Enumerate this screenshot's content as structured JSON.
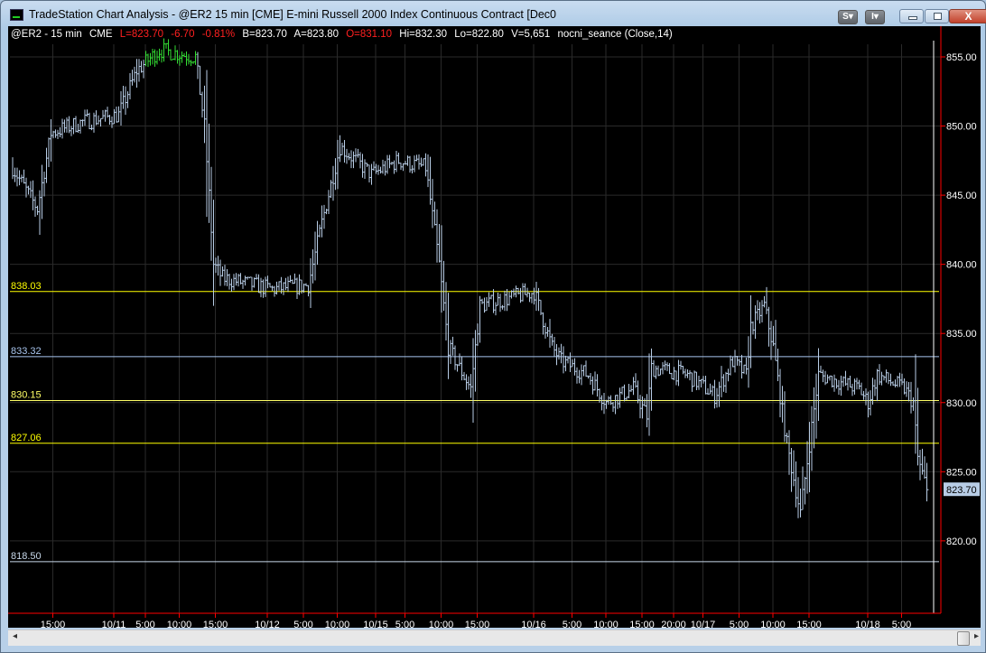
{
  "window": {
    "title": "TradeStation Chart Analysis - @ER2  15 min  [CME] E-mini Russell 2000 Index Continuous Contract [Dec0",
    "buttons": {
      "s": "S",
      "i": "I",
      "minimize": "minimize",
      "maximize": "maximize",
      "close": "X"
    }
  },
  "info": {
    "symbol": "@ER2 - 15 min",
    "exchange": "CME",
    "last": "L=823.70",
    "change": "-6.70",
    "change_pct": "-0.81%",
    "bid": "B=823.70",
    "ask": "A=823.80",
    "open": "O=831.10",
    "high": "Hi=832.30",
    "low": "Lo=822.80",
    "volume": "V=5,651",
    "indicator": "nocni_seance (Close,14)"
  },
  "colors": {
    "bars": "#b8cde6",
    "bars_alt": "#33dd33",
    "yellow": "#ffff00",
    "blue_level": "#a9c6ef",
    "axis": "#ff0000",
    "grid": "#2a2a2a"
  },
  "chart_data": {
    "type": "ohlc",
    "symbol": "@ER2",
    "interval": "15 min",
    "ylim": [
      817,
      857
    ],
    "yticks": [
      "855.00",
      "850.00",
      "845.00",
      "840.00",
      "835.00",
      "830.00",
      "825.00",
      "820.00"
    ],
    "ytick_values": [
      855,
      850,
      845,
      840,
      835,
      830,
      825,
      820
    ],
    "last_price_label": "823.70",
    "last_price": 823.7,
    "bar_count": 412,
    "close_keypoints": [
      [
        1,
        847
      ],
      [
        12,
        844
      ],
      [
        18,
        849.5
      ],
      [
        32,
        850.3
      ],
      [
        48,
        850.8
      ],
      [
        56,
        854
      ],
      [
        66,
        855.5
      ],
      [
        82,
        855
      ],
      [
        86,
        850
      ],
      [
        90,
        840
      ],
      [
        94,
        839
      ],
      [
        116,
        838.2
      ],
      [
        132,
        838.5
      ],
      [
        138,
        843
      ],
      [
        146,
        848.5
      ],
      [
        160,
        846.5
      ],
      [
        172,
        847.5
      ],
      [
        184,
        847
      ],
      [
        190,
        840
      ],
      [
        194,
        834
      ],
      [
        204,
        831
      ],
      [
        208,
        837
      ],
      [
        220,
        837.5
      ],
      [
        232,
        838
      ],
      [
        240,
        834
      ],
      [
        244,
        833
      ],
      [
        256,
        832
      ],
      [
        264,
        830
      ],
      [
        276,
        831
      ],
      [
        282,
        829
      ],
      [
        284,
        832.5
      ],
      [
        300,
        832
      ],
      [
        312,
        830.5
      ],
      [
        320,
        833
      ],
      [
        326,
        832
      ],
      [
        328,
        835.5
      ],
      [
        334,
        837
      ],
      [
        338,
        834
      ],
      [
        344,
        827
      ],
      [
        350,
        822
      ],
      [
        354,
        827
      ],
      [
        358,
        832
      ],
      [
        376,
        831
      ],
      [
        380,
        830
      ],
      [
        384,
        832
      ],
      [
        396,
        831
      ],
      [
        400,
        830
      ],
      [
        402,
        826
      ],
      [
        406,
        823.7
      ]
    ],
    "levels": [
      {
        "label": "838.03",
        "value": 838.03,
        "color": "#ffff00"
      },
      {
        "label": "833.32",
        "value": 833.32,
        "color": "#a9c6ef"
      },
      {
        "label": "830.15",
        "value": 830.15,
        "color": "#ffff66"
      },
      {
        "label": "827.06",
        "value": 827.06,
        "color": "#ffff00"
      },
      {
        "label": "818.50",
        "value": 818.5,
        "color": "#c8d8ea"
      }
    ],
    "xticks": [
      {
        "label": "15:00",
        "bar": 19
      },
      {
        "label": "10/11",
        "bar": 46
      },
      {
        "label": "5:00",
        "bar": 60
      },
      {
        "label": "10:00",
        "bar": 75
      },
      {
        "label": "15:00",
        "bar": 91
      },
      {
        "label": "10/12",
        "bar": 114
      },
      {
        "label": "5:00",
        "bar": 130
      },
      {
        "label": "10:00",
        "bar": 145
      },
      {
        "label": "10/15",
        "bar": 162
      },
      {
        "label": "5:00",
        "bar": 175
      },
      {
        "label": "10:00",
        "bar": 191
      },
      {
        "label": "15:00",
        "bar": 207
      },
      {
        "label": "10/16",
        "bar": 232
      },
      {
        "label": "5:00",
        "bar": 249
      },
      {
        "label": "10:00",
        "bar": 264
      },
      {
        "label": "15:00",
        "bar": 280
      },
      {
        "label": "20:00",
        "bar": 294
      },
      {
        "label": "10/17",
        "bar": 307
      },
      {
        "label": "5:00",
        "bar": 323
      },
      {
        "label": "10:00",
        "bar": 338
      },
      {
        "label": "15:00",
        "bar": 354
      },
      {
        "label": "10/18",
        "bar": 380
      },
      {
        "label": "5:00",
        "bar": 395
      }
    ]
  }
}
